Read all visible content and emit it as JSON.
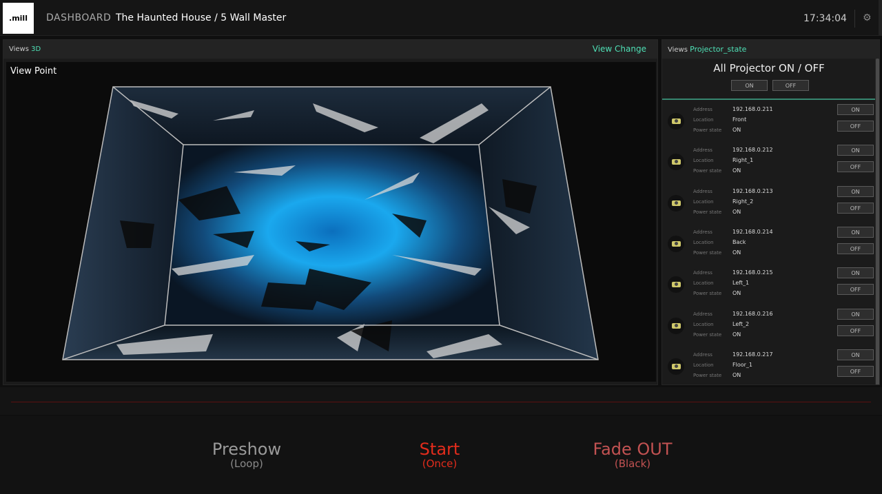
{
  "header": {
    "logo": ".mill",
    "nav_label": "DASHBOARD",
    "title": "The Haunted House / 5 Wall Master",
    "clock": "17:34:04",
    "settings_icon": "gear-icon"
  },
  "view3d": {
    "views_label": "Views",
    "views_mode": "3D",
    "view_change": "View Change",
    "viewpoint_label": "View Point"
  },
  "projectors": {
    "views_label": "Views",
    "views_mode": "Projector_state",
    "all_title": "All Projector ON / OFF",
    "all_on": "ON",
    "all_off": "OFF",
    "field_labels": {
      "address": "Address",
      "location": "Location",
      "power": "Power state"
    },
    "on_label": "ON",
    "off_label": "OFF",
    "items": [
      {
        "address": "192.168.0.211",
        "location": "Front",
        "power": "ON"
      },
      {
        "address": "192.168.0.212",
        "location": "Right_1",
        "power": "ON"
      },
      {
        "address": "192.168.0.213",
        "location": "Right_2",
        "power": "ON"
      },
      {
        "address": "192.168.0.214",
        "location": "Back",
        "power": "ON"
      },
      {
        "address": "192.168.0.215",
        "location": "Left_1",
        "power": "ON"
      },
      {
        "address": "192.168.0.216",
        "location": "Left_2",
        "power": "ON"
      },
      {
        "address": "192.168.0.217",
        "location": "Floor_1",
        "power": "ON"
      }
    ]
  },
  "controls": {
    "preshow": {
      "title": "Preshow",
      "sub": "(Loop)"
    },
    "start": {
      "title": "Start",
      "sub": "(Once)"
    },
    "fade": {
      "title": "Fade OUT",
      "sub": "(Black)"
    }
  },
  "colors": {
    "accent": "#4fe0b6",
    "start_red": "#e32c1c",
    "fade_red": "#c25252"
  }
}
